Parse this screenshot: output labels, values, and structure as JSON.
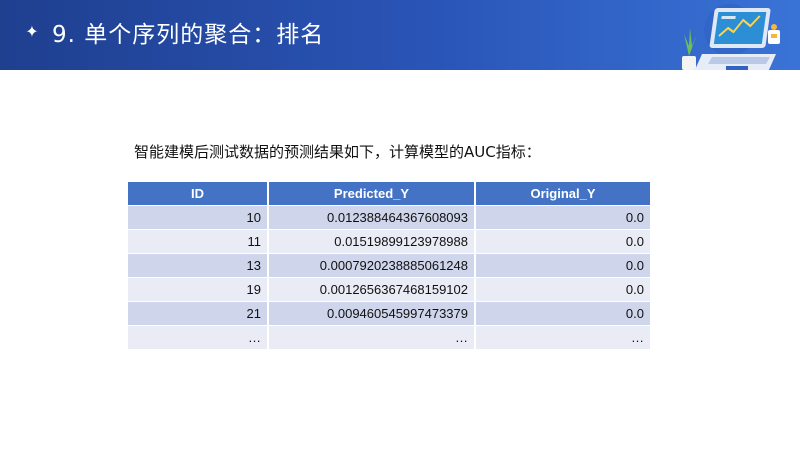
{
  "header": {
    "title": "9. 单个序列的聚合：排名",
    "bg_start": "#1f3f8f",
    "bg_end": "#3a73d6"
  },
  "intro_text": "智能建模后测试数据的预测结果如下，计算模型的AUC指标：",
  "table": {
    "columns": [
      "ID",
      "Predicted_Y",
      "Original_Y"
    ],
    "rows": [
      [
        "10",
        "0.012388464367608093",
        "0.0"
      ],
      [
        "11",
        "0.01519899123978988",
        "0.0"
      ],
      [
        "13",
        "0.0007920238885061248",
        "0.0"
      ],
      [
        "19",
        "0.0012656367468159102",
        "0.0"
      ],
      [
        "21",
        "0.009460545997473379",
        "0.0"
      ],
      [
        "…",
        "…",
        "…"
      ]
    ],
    "header_color": "#4472c4",
    "row_color_odd": "#cfd5ea",
    "row_color_even": "#e9ebf5"
  },
  "icons": [
    "sparkle-icon",
    "laptop-illustration-icon"
  ]
}
